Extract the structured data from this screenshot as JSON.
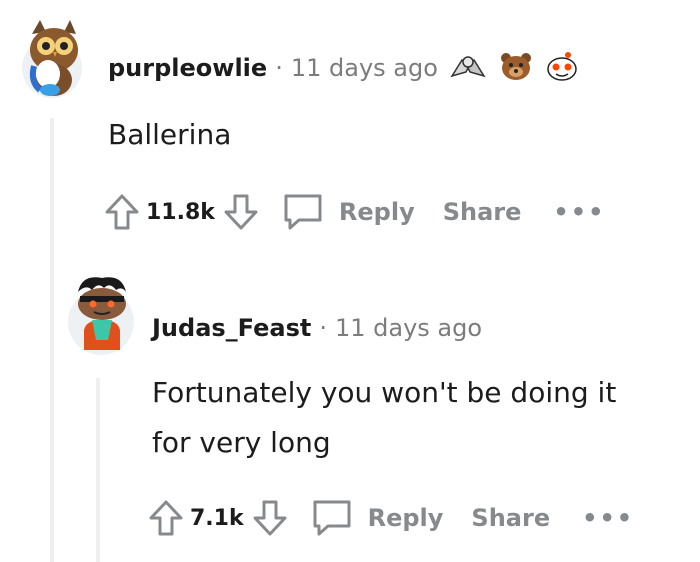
{
  "comments": [
    {
      "username": "purpleowlie",
      "separator": "·",
      "time": "11 days ago",
      "awards": [
        "arm-wrestle-award-icon",
        "bear-award-icon",
        "snoo-award-icon"
      ],
      "body": "Ballerina",
      "score": "11.8k",
      "reply_label": "Reply",
      "share_label": "Share",
      "more_label": "•••"
    },
    {
      "username": "Judas_Feast",
      "separator": "·",
      "time": "11 days ago",
      "body_lines": [
        "Fortunately you won't be doing it",
        "for very long"
      ],
      "score": "7.1k",
      "reply_label": "Reply",
      "share_label": "Share",
      "more_label": "•••"
    }
  ],
  "colors": {
    "text": "#1c1c1c",
    "meta": "#7c7c7c",
    "action": "#878a8c",
    "thread_line": "#edeff1"
  }
}
